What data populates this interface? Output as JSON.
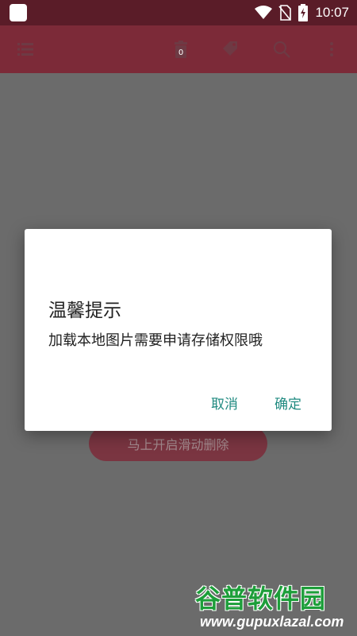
{
  "status_bar": {
    "time": "10:07"
  },
  "toolbar": {
    "icons": [
      "menu-list-icon",
      "trash-icon",
      "tag-icon",
      "search-icon",
      "more-vert-icon"
    ],
    "trash_badge": "0"
  },
  "main": {
    "enable_swipe_label": "马上开启滑动删除"
  },
  "dialog": {
    "title": "温馨提示",
    "message": "加载本地图片需要申请存储权限哦",
    "cancel_label": "取消",
    "confirm_label": "确定"
  },
  "watermark": {
    "top": "谷普软件园",
    "bottom": "www.gupuxlazal.com"
  },
  "colors": {
    "toolbar": "#7c2a38",
    "status_bar": "#5a1c28",
    "accent": "#1f8a80",
    "overlay": "#6b6b6b"
  }
}
